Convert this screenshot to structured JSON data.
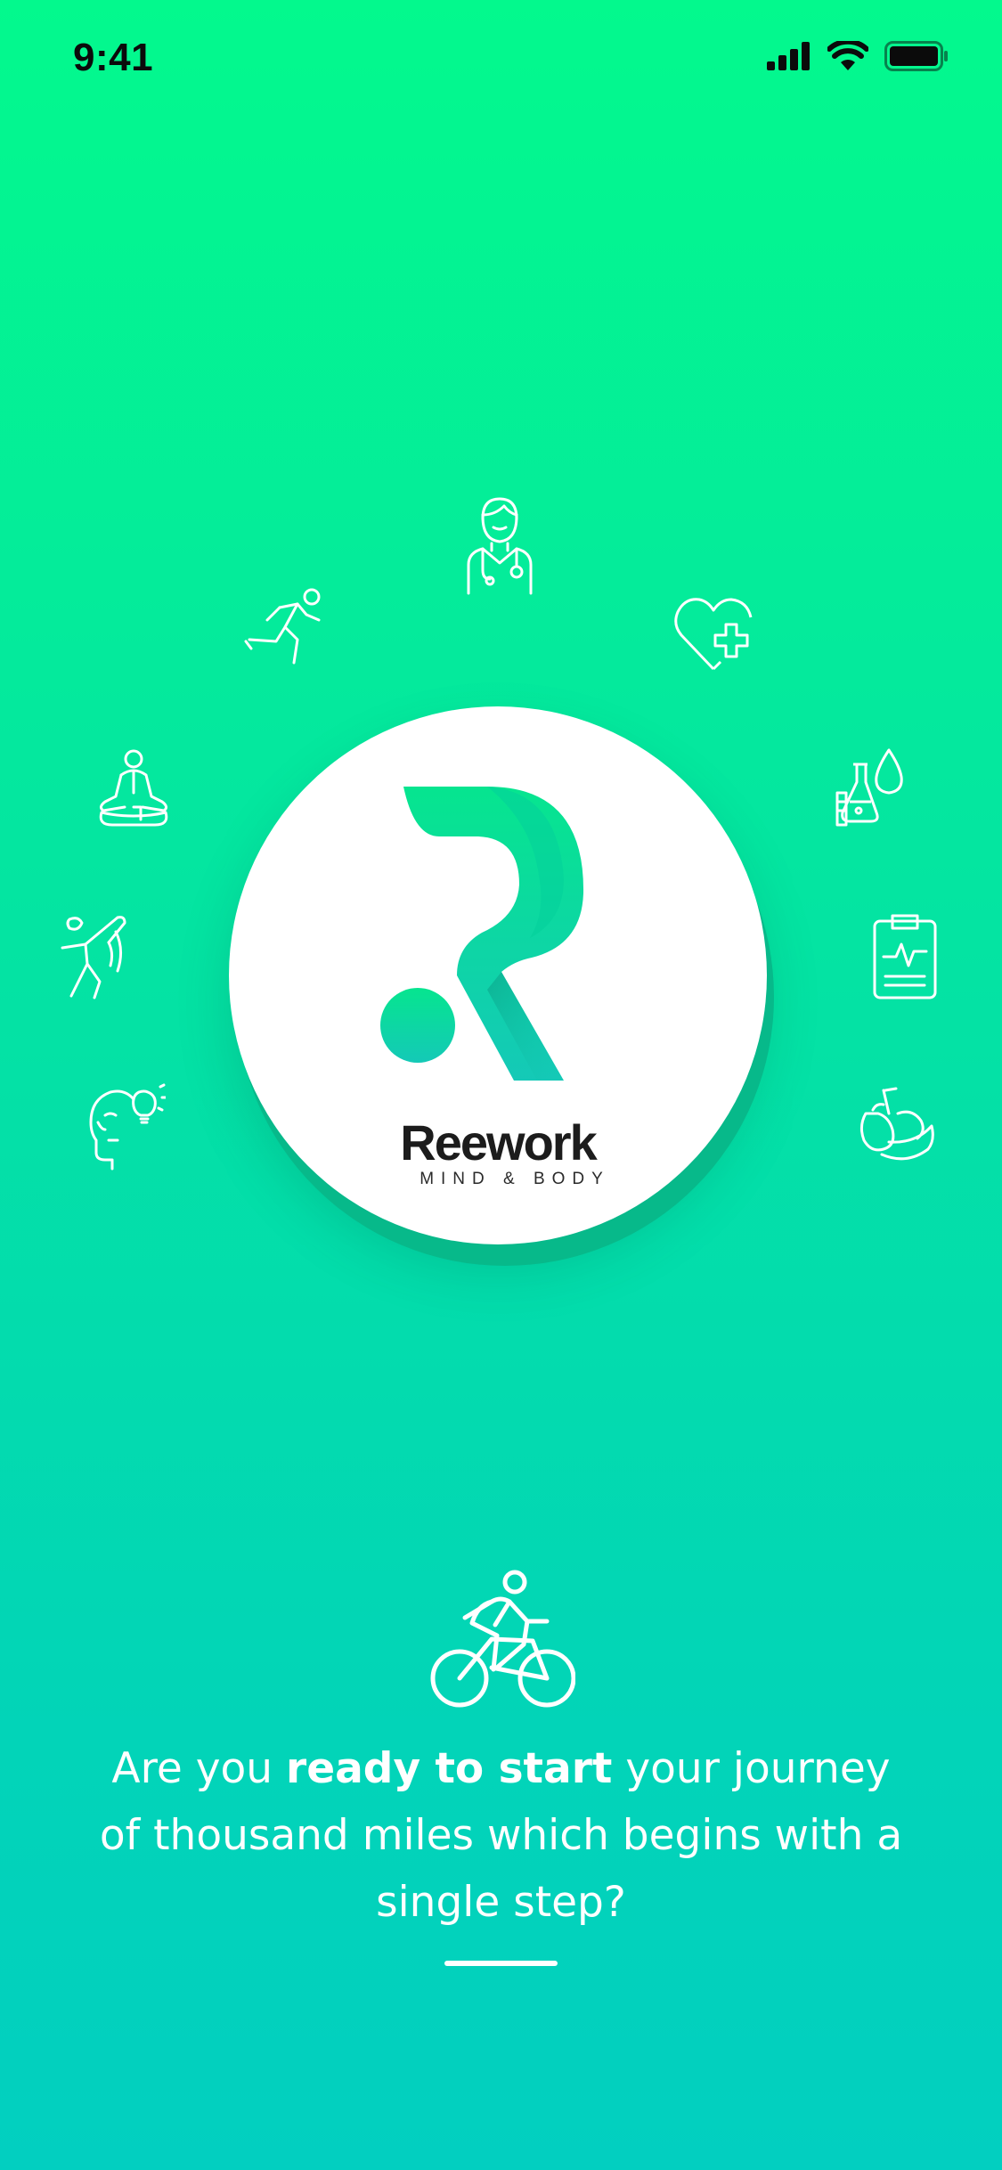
{
  "status_bar": {
    "time": "9:41",
    "icons": [
      "cellular-signal-icon",
      "wifi-icon",
      "battery-icon"
    ]
  },
  "logo": {
    "brand_name": "Reework",
    "tagline": "MIND & BODY",
    "mark_icon": "reework-r-logo-icon"
  },
  "orbit_icons": [
    "doctor-icon",
    "heart-plus-icon",
    "lab-flask-drop-icon",
    "clipboard-heartbeat-icon",
    "fruit-drink-icon",
    "head-lightbulb-icon",
    "yoga-stretch-icon",
    "meditation-icon",
    "runner-icon"
  ],
  "intro": {
    "icon": "cyclist-icon",
    "headline_part1": "Are you ",
    "headline_bold": "ready to start",
    "headline_part2": " your journey of thousand miles which begins with a single step?"
  },
  "colors": {
    "gradient_top": "#03f98d",
    "gradient_bottom": "#02cfc0",
    "logo_green": "#06e58f",
    "logo_teal": "#14c9b7",
    "disc_shadow": "#07b98a"
  }
}
